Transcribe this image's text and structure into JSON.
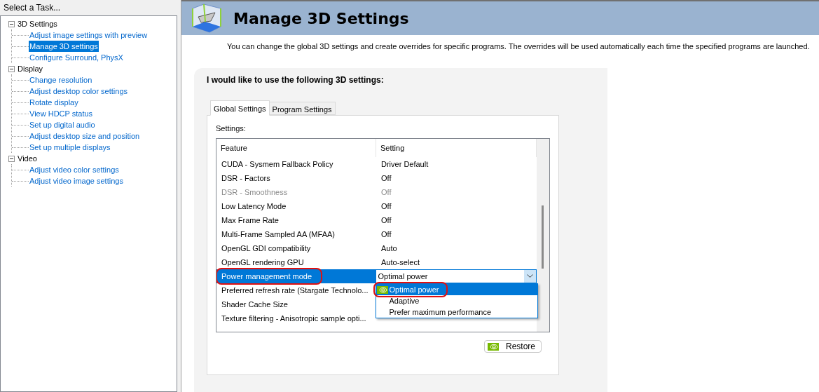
{
  "sidebar": {
    "title": "Select a Task...",
    "tree": [
      {
        "label": "3D Settings",
        "expanded": true,
        "selected": false,
        "children": [
          {
            "label": "Adjust image settings with preview",
            "selected": false
          },
          {
            "label": "Manage 3D settings",
            "selected": true
          },
          {
            "label": "Configure Surround, PhysX",
            "selected": false
          }
        ]
      },
      {
        "label": "Display",
        "expanded": true,
        "selected": false,
        "children": [
          {
            "label": "Change resolution",
            "selected": false
          },
          {
            "label": "Adjust desktop color settings",
            "selected": false
          },
          {
            "label": "Rotate display",
            "selected": false
          },
          {
            "label": "View HDCP status",
            "selected": false
          },
          {
            "label": "Set up digital audio",
            "selected": false
          },
          {
            "label": "Adjust desktop size and position",
            "selected": false
          },
          {
            "label": "Set up multiple displays",
            "selected": false
          }
        ]
      },
      {
        "label": "Video",
        "expanded": true,
        "selected": false,
        "children": [
          {
            "label": "Adjust video color settings",
            "selected": false
          },
          {
            "label": "Adjust video image settings",
            "selected": false
          }
        ]
      }
    ]
  },
  "page": {
    "title": "Manage 3D Settings",
    "description": "You can change the global 3D settings and create overrides for specific programs. The overrides will be used automatically each time the specified programs are launched."
  },
  "panel": {
    "heading": "I would like to use the following 3D settings:",
    "tabs": [
      {
        "label": "Global Settings",
        "selected": true
      },
      {
        "label": "Program Settings",
        "selected": false
      }
    ],
    "settings_label": "Settings:",
    "columns": [
      "Feature",
      "Setting"
    ],
    "rows": [
      {
        "feature": "CUDA - Sysmem Fallback Policy",
        "setting": "Driver Default",
        "disabled": false,
        "selected": false
      },
      {
        "feature": "DSR - Factors",
        "setting": "Off",
        "disabled": false,
        "selected": false
      },
      {
        "feature": "DSR - Smoothness",
        "setting": "Off",
        "disabled": true,
        "selected": false
      },
      {
        "feature": "Low Latency Mode",
        "setting": "Off",
        "disabled": false,
        "selected": false
      },
      {
        "feature": "Max Frame Rate",
        "setting": "Off",
        "disabled": false,
        "selected": false
      },
      {
        "feature": "Multi-Frame Sampled AA (MFAA)",
        "setting": "Off",
        "disabled": false,
        "selected": false
      },
      {
        "feature": "OpenGL GDI compatibility",
        "setting": "Auto",
        "disabled": false,
        "selected": false
      },
      {
        "feature": "OpenGL rendering GPU",
        "setting": "Auto-select",
        "disabled": false,
        "selected": false
      },
      {
        "feature": "Power management mode",
        "disabled": false,
        "selected": true,
        "annotated": true,
        "dropdown": {
          "value": "Optimal power",
          "options": [
            {
              "label": "Optimal power",
              "selected": true,
              "annotated": true
            },
            {
              "label": "Adaptive",
              "selected": false,
              "annotated": false
            },
            {
              "label": "Prefer maximum performance",
              "selected": false,
              "annotated": false
            }
          ]
        }
      },
      {
        "feature": "Preferred refresh rate (Stargate Technolo...",
        "disabled": false,
        "selected": false
      },
      {
        "feature": "Shader Cache Size",
        "disabled": false,
        "selected": false
      },
      {
        "feature": "Texture filtering - Anisotropic sample opti...",
        "disabled": false,
        "selected": false
      }
    ],
    "restore_button": "Restore"
  }
}
